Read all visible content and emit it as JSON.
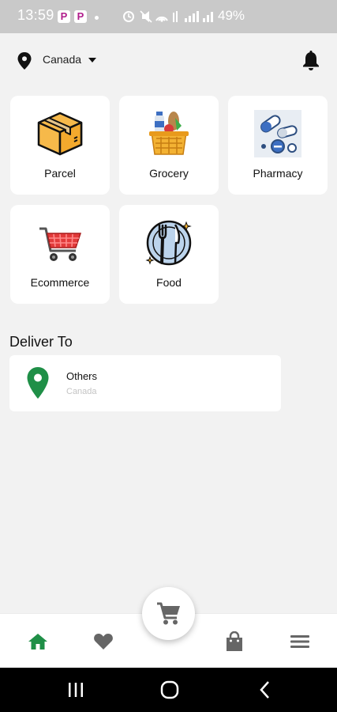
{
  "status_bar": {
    "time": "13:59",
    "app_badges": [
      "P",
      "P"
    ],
    "battery": "49%"
  },
  "header": {
    "location": "Canada",
    "icons": [
      "location-pin-icon",
      "chevron-down-icon",
      "bell-icon"
    ]
  },
  "categories": [
    {
      "label": "Parcel",
      "icon": "parcel-box-icon"
    },
    {
      "label": "Grocery",
      "icon": "grocery-basket-icon"
    },
    {
      "label": "Pharmacy",
      "icon": "pharmacy-pills-icon"
    },
    {
      "label": "Ecommerce",
      "icon": "shopping-cart-icon"
    },
    {
      "label": "Food",
      "icon": "plate-fork-knife-icon"
    }
  ],
  "deliver_to": {
    "title": "Deliver To",
    "address": {
      "name": "Others",
      "country": "Canada"
    }
  },
  "bottom_nav": {
    "items": [
      "home-icon",
      "heart-icon",
      "cart-icon",
      "shopping-bag-icon",
      "menu-icon"
    ],
    "active": "home-icon"
  },
  "colors": {
    "accent_green": "#1f8f47",
    "background": "#f2f2f2",
    "cart_red": "#e23b3b"
  }
}
